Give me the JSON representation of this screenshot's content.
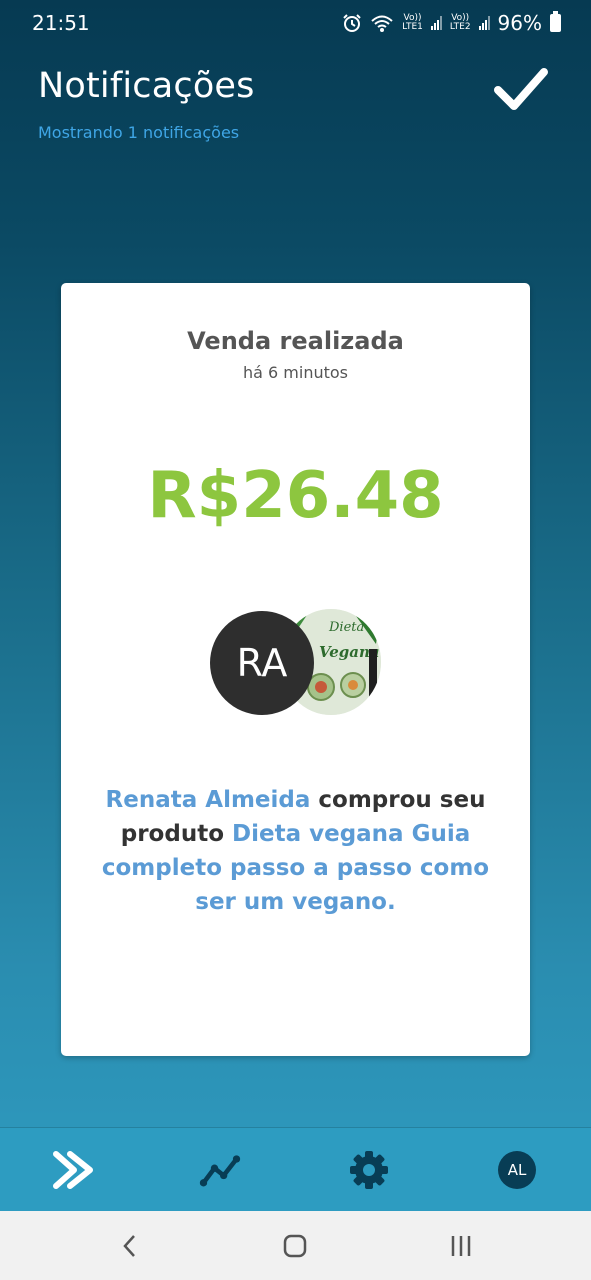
{
  "status_bar": {
    "time": "21:51",
    "sim1": "Vo))\nLTE1",
    "sim1_top": "Vo))",
    "sim1_bottom": "LTE1",
    "sim2_top": "Vo))",
    "sim2_bottom": "LTE2",
    "battery": "96%",
    "icons": [
      "alarm-icon",
      "wifi-icon",
      "signal-icon",
      "battery-icon"
    ]
  },
  "header": {
    "title": "Notificações",
    "subtitle": "Mostrando 1 notificações",
    "confirm_icon": "check-icon"
  },
  "notification": {
    "title": "Venda realizada",
    "time": "há 6 minutos",
    "amount": "R$26.48",
    "buyer_initials": "RA",
    "product_image_texts": [
      "Dieta",
      "Vegana"
    ],
    "message": {
      "buyer": "Renata Almeida",
      "text_middle": " comprou seu produto ",
      "product": "Dieta vegana Guia completo passo a passo como ser um vegano."
    }
  },
  "bottom_nav": {
    "items": [
      {
        "name": "notifications",
        "icon": "double-chevron-icon"
      },
      {
        "name": "analytics",
        "icon": "trend-line-icon"
      },
      {
        "name": "settings",
        "icon": "gear-icon"
      },
      {
        "name": "profile",
        "label": "AL"
      }
    ]
  },
  "colors": {
    "accent_green": "#8dc63f",
    "link_blue": "#5b9bd5",
    "subtitle_blue": "#3fa6e6",
    "nav_bar": "#2d9cc1",
    "dark_navy": "#063a52"
  }
}
